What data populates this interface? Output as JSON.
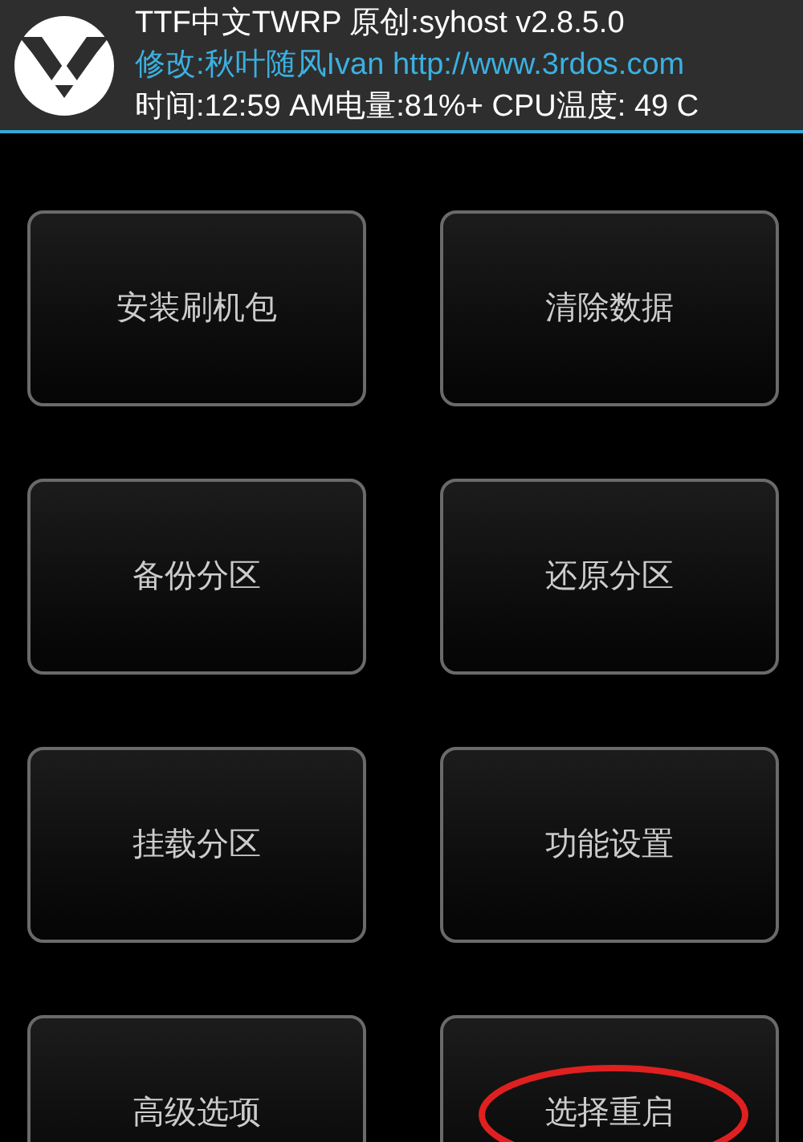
{
  "header": {
    "title": "TTF中文TWRP 原创:syhost v2.8.5.0",
    "credit": "修改:秋叶随风Ivan http://www.3rdos.com",
    "status": "时间:12:59 AM电量:81%+  CPU温度: 49 C"
  },
  "buttons": [
    {
      "label": "安装刷机包",
      "circled": false
    },
    {
      "label": "清除数据",
      "circled": false
    },
    {
      "label": "备份分区",
      "circled": false
    },
    {
      "label": "还原分区",
      "circled": false
    },
    {
      "label": "挂载分区",
      "circled": false
    },
    {
      "label": "功能设置",
      "circled": false
    },
    {
      "label": "高级选项",
      "circled": false
    },
    {
      "label": "选择重启",
      "circled": true
    }
  ]
}
